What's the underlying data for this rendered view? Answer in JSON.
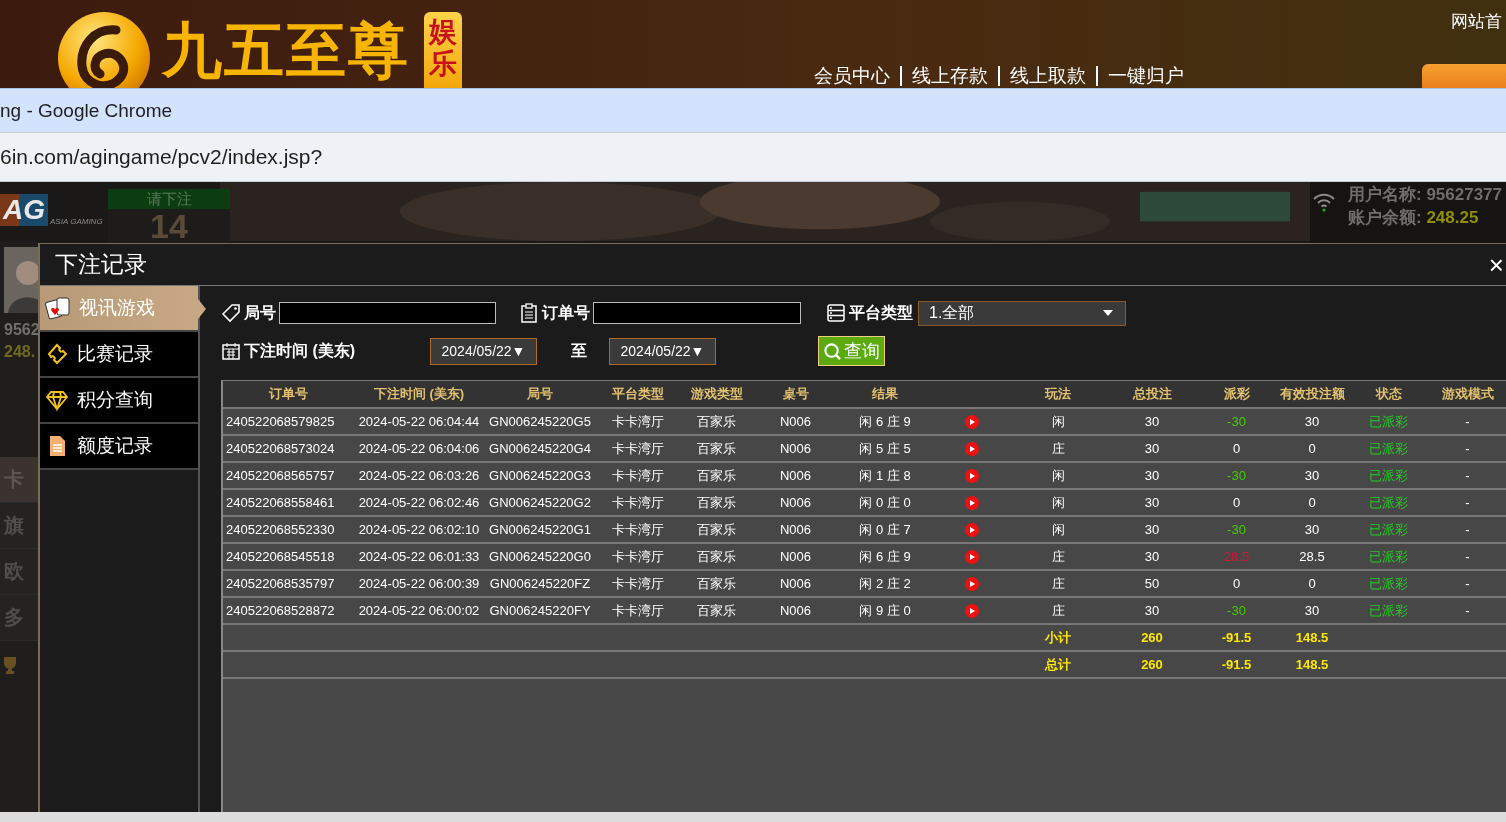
{
  "site_header": {
    "brand": "九五至尊",
    "badge": [
      "娱",
      "乐"
    ],
    "nav": [
      "会员中心",
      "线上存款",
      "线上取款",
      "一键归户"
    ],
    "top_link": "网站首"
  },
  "browser": {
    "title": "ng - Google Chrome",
    "url": "6in.com/agingame/pcv2/index.jsp?"
  },
  "game": {
    "logo": "AG",
    "logo_tagline": "ASIA GAMING",
    "countdown_label": "请下注",
    "countdown": "14",
    "player_id": "9562",
    "player_balance": "248.",
    "lobby_items": [
      "卡",
      "旗",
      "欧",
      "多"
    ],
    "user_name_label": "用户名称:",
    "user_name": "95627377",
    "balance_label": "账户余额:",
    "balance": "248.25"
  },
  "dialog": {
    "title": "下注记录",
    "close": "×",
    "menu": [
      {
        "label": "视讯游戏",
        "selected": true
      },
      {
        "label": "比赛记录",
        "selected": false
      },
      {
        "label": "积分查询",
        "selected": false
      },
      {
        "label": "额度记录",
        "selected": false
      }
    ],
    "filters": {
      "round_label": "局号",
      "order_label": "订单号",
      "platform_label": "平台类型",
      "platform_value": "1.全部",
      "time_label": "下注时间 (美东)",
      "date_from": "2024/05/22▼",
      "to_label": "至",
      "date_to": "2024/05/22▼",
      "query_button": "查询"
    },
    "table": {
      "columns": [
        "订单号",
        "下注时间 (美东)",
        "局号",
        "平台类型",
        "游戏类型",
        "桌号",
        "结果",
        "玩法",
        "总投注",
        "派彩",
        "有效投注额",
        "状态",
        "游戏模式"
      ],
      "rows": [
        {
          "order": "240522068579825",
          "time": "2024-05-22 06:04:44",
          "round": "GN006245220G5",
          "platform": "卡卡湾厅",
          "game": "百家乐",
          "table": "N006",
          "result": "闲 6 庄 9",
          "bet_on": "闲",
          "total": "30",
          "payout": {
            "text": "-30",
            "color": "#44cc00"
          },
          "valid": "30",
          "status": "已派彩",
          "mode": "-"
        },
        {
          "order": "240522068573024",
          "time": "2024-05-22 06:04:06",
          "round": "GN006245220G4",
          "platform": "卡卡湾厅",
          "game": "百家乐",
          "table": "N006",
          "result": "闲 5 庄 5",
          "bet_on": "庄",
          "total": "30",
          "payout": {
            "text": "0",
            "color": "#ffffff"
          },
          "valid": "0",
          "status": "已派彩",
          "mode": "-"
        },
        {
          "order": "240522068565757",
          "time": "2024-05-22 06:03:26",
          "round": "GN006245220G3",
          "platform": "卡卡湾厅",
          "game": "百家乐",
          "table": "N006",
          "result": "闲 1 庄 8",
          "bet_on": "闲",
          "total": "30",
          "payout": {
            "text": "-30",
            "color": "#44cc00"
          },
          "valid": "30",
          "status": "已派彩",
          "mode": "-"
        },
        {
          "order": "240522068558461",
          "time": "2024-05-22 06:02:46",
          "round": "GN006245220G2",
          "platform": "卡卡湾厅",
          "game": "百家乐",
          "table": "N006",
          "result": "闲 0 庄 0",
          "bet_on": "闲",
          "total": "30",
          "payout": {
            "text": "0",
            "color": "#ffffff"
          },
          "valid": "0",
          "status": "已派彩",
          "mode": "-"
        },
        {
          "order": "240522068552330",
          "time": "2024-05-22 06:02:10",
          "round": "GN006245220G1",
          "platform": "卡卡湾厅",
          "game": "百家乐",
          "table": "N006",
          "result": "闲 0 庄 7",
          "bet_on": "闲",
          "total": "30",
          "payout": {
            "text": "-30",
            "color": "#44cc00"
          },
          "valid": "30",
          "status": "已派彩",
          "mode": "-"
        },
        {
          "order": "240522068545518",
          "time": "2024-05-22 06:01:33",
          "round": "GN006245220G0",
          "platform": "卡卡湾厅",
          "game": "百家乐",
          "table": "N006",
          "result": "闲 6 庄 9",
          "bet_on": "庄",
          "total": "30",
          "payout": {
            "text": "28.5",
            "color": "#dd1133"
          },
          "valid": "28.5",
          "status": "已派彩",
          "mode": "-"
        },
        {
          "order": "240522068535797",
          "time": "2024-05-22 06:00:39",
          "round": "GN006245220FZ",
          "platform": "卡卡湾厅",
          "game": "百家乐",
          "table": "N006",
          "result": "闲 2 庄 2",
          "bet_on": "庄",
          "total": "50",
          "payout": {
            "text": "0",
            "color": "#ffffff"
          },
          "valid": "0",
          "status": "已派彩",
          "mode": "-"
        },
        {
          "order": "240522068528872",
          "time": "2024-05-22 06:00:02",
          "round": "GN006245220FY",
          "platform": "卡卡湾厅",
          "game": "百家乐",
          "table": "N006",
          "result": "闲 9 庄 0",
          "bet_on": "庄",
          "total": "30",
          "payout": {
            "text": "-30",
            "color": "#44cc00"
          },
          "valid": "30",
          "status": "已派彩",
          "mode": "-"
        }
      ],
      "summary": [
        {
          "label": "小计",
          "total": "260",
          "payout": "-91.5",
          "valid": "148.5"
        },
        {
          "label": "总计",
          "total": "260",
          "payout": "-91.5",
          "valid": "148.5"
        }
      ]
    }
  }
}
